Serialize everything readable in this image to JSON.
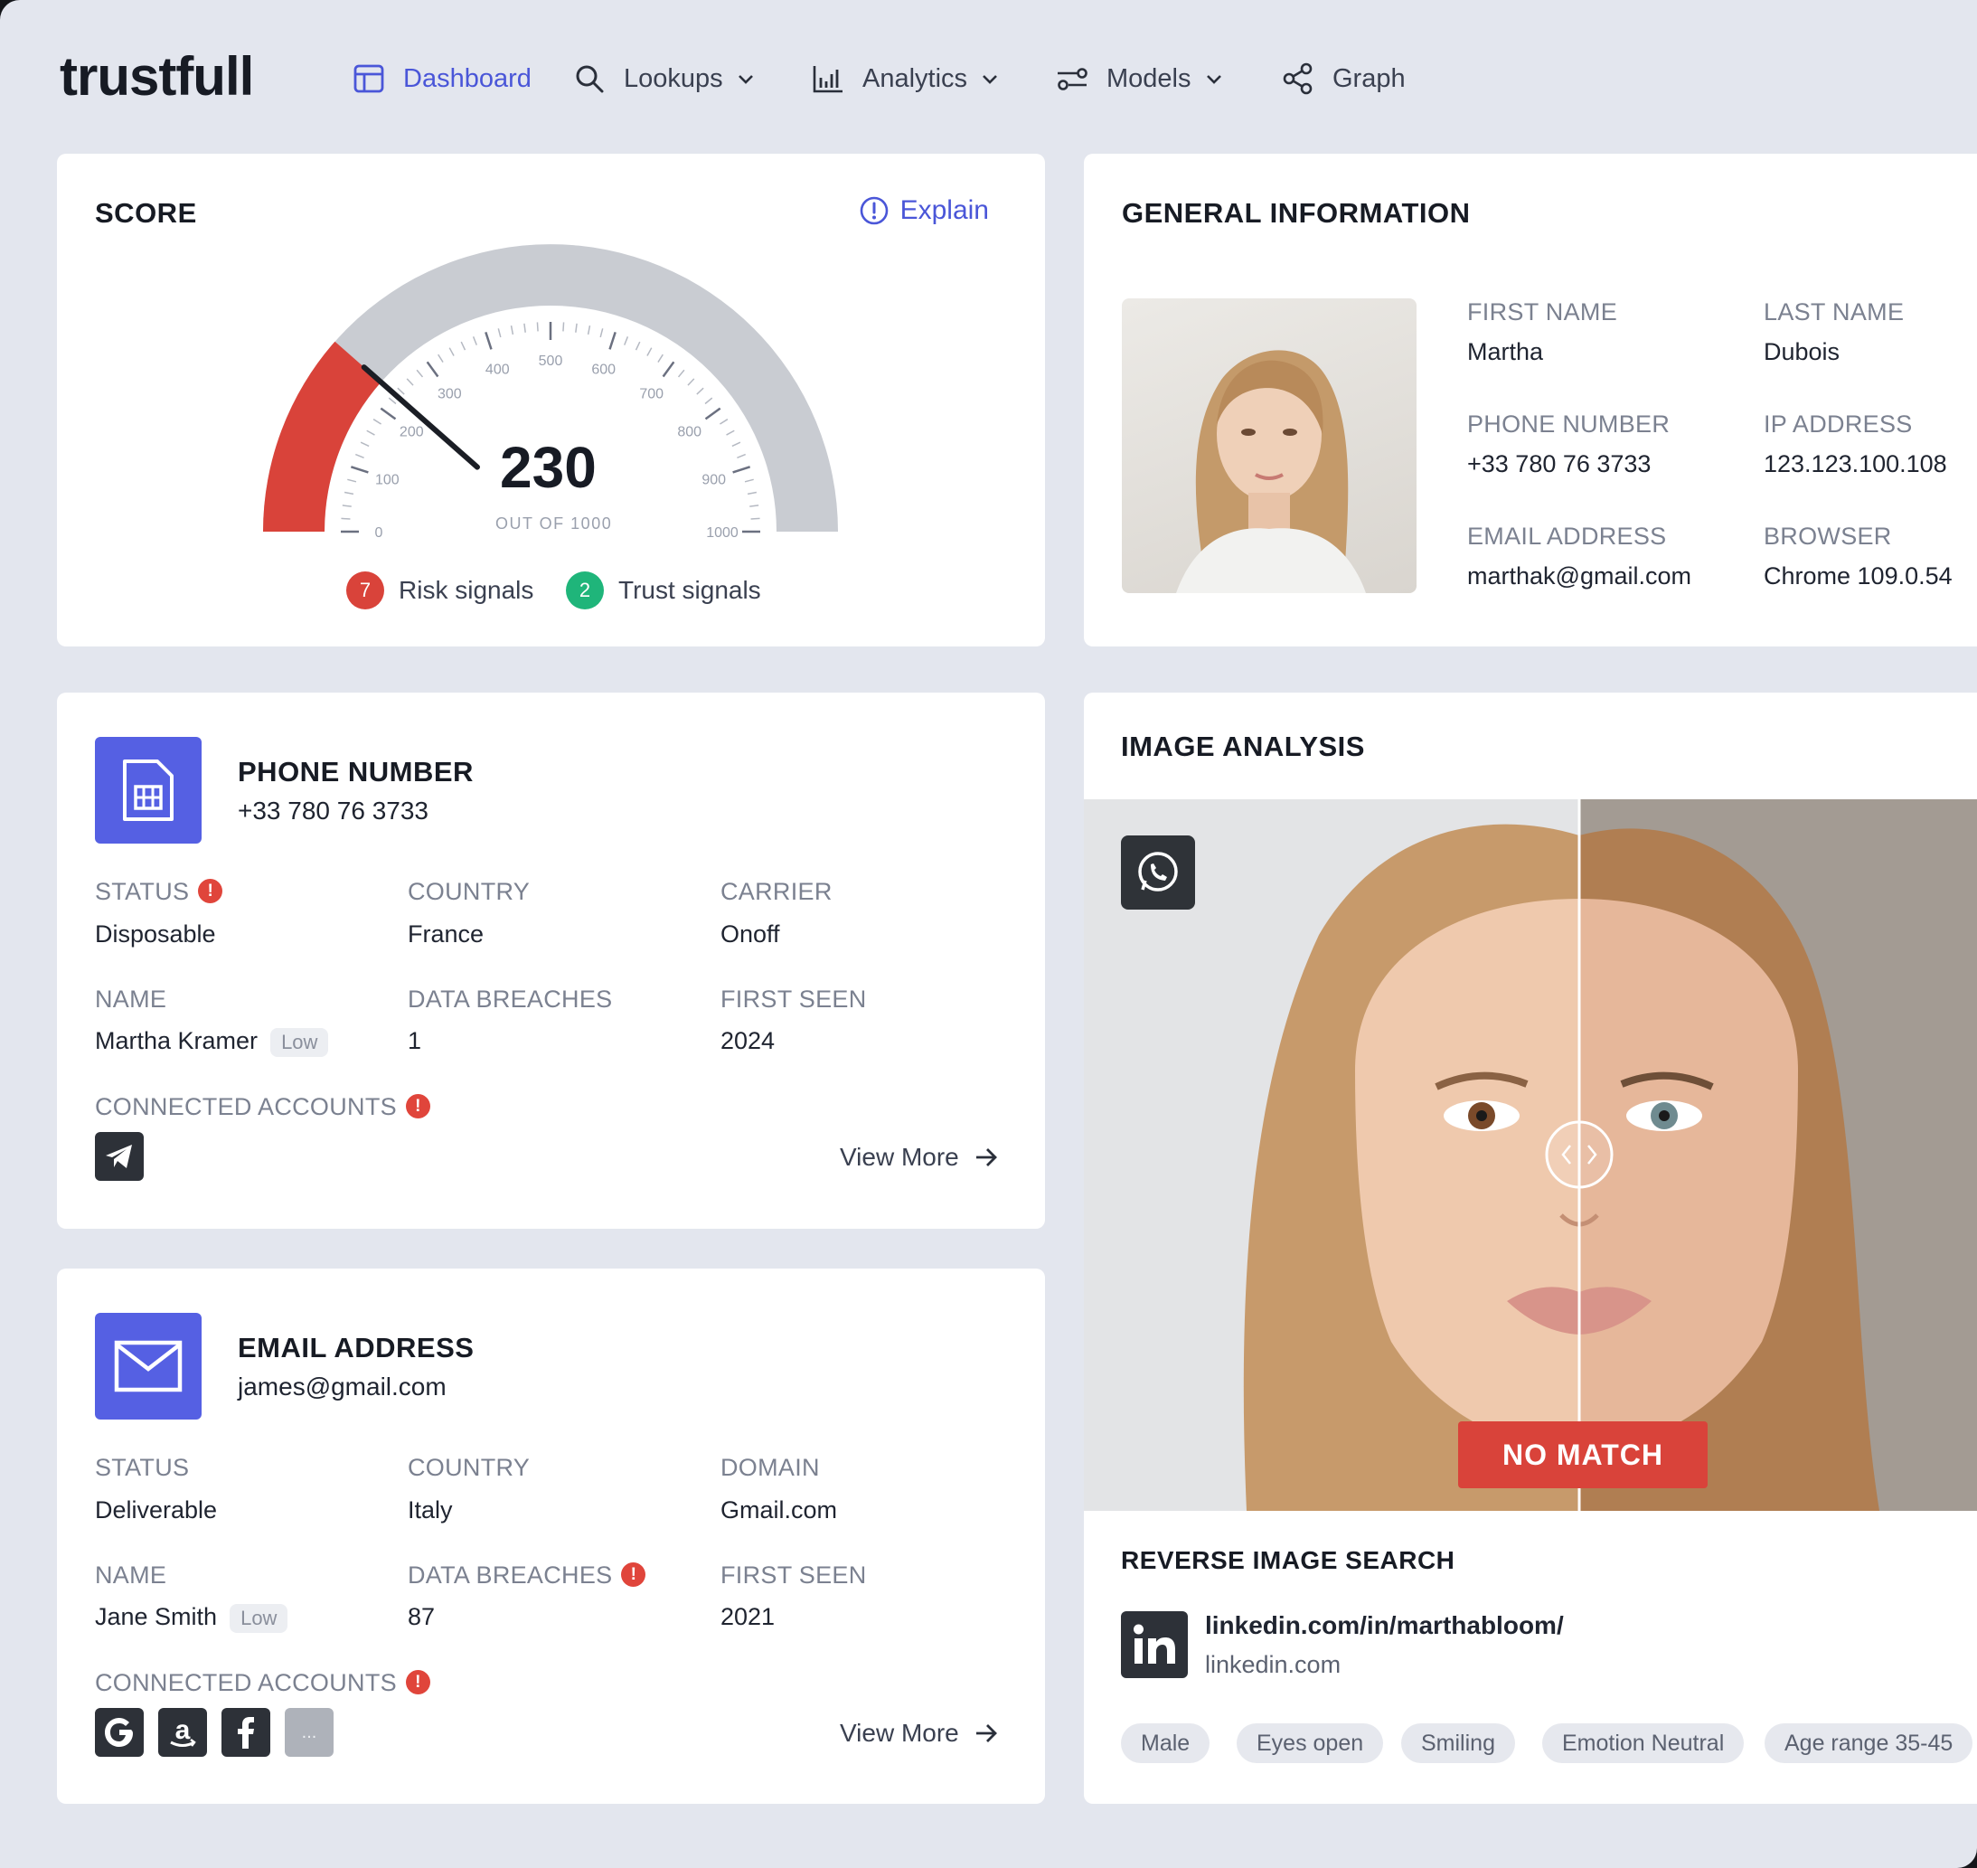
{
  "brand": "trustfull",
  "nav": {
    "dashboard": "Dashboard",
    "lookups": "Lookups",
    "analytics": "Analytics",
    "models": "Models",
    "graph": "Graph"
  },
  "score": {
    "title": "SCORE",
    "explain": "Explain",
    "value": "230",
    "out_of": "OUT OF 1000",
    "ticks": [
      "0",
      "100",
      "200",
      "300",
      "400",
      "500",
      "600",
      "700",
      "800",
      "900",
      "1000"
    ],
    "risk_count": "7",
    "risk_label": "Risk signals",
    "trust_count": "2",
    "trust_label": "Trust signals"
  },
  "general": {
    "title": "GENERAL INFORMATION",
    "first_name_label": "FIRST NAME",
    "first_name": "Martha",
    "last_name_label": "LAST NAME",
    "last_name": "Dubois",
    "phone_label": "PHONE NUMBER",
    "phone": "+33 780 76 3733",
    "ip_label": "IP ADDRESS",
    "ip": "123.123.100.108",
    "email_label": "EMAIL ADDRESS",
    "email": "marthak@gmail.com",
    "browser_label": "BROWSER",
    "browser": "Chrome 109.0.54"
  },
  "phone_card": {
    "title": "PHONE NUMBER",
    "number": "+33 780 76 3733",
    "status_label": "STATUS",
    "status": "Disposable",
    "country_label": "COUNTRY",
    "country": "France",
    "carrier_label": "CARRIER",
    "carrier": "Onoff",
    "name_label": "NAME",
    "name": "Martha Kramer",
    "name_badge": "Low",
    "breaches_label": "DATA BREACHES",
    "breaches": "1",
    "first_seen_label": "FIRST SEEN",
    "first_seen": "2024",
    "connected_label": "CONNECTED ACCOUNTS",
    "view_more": "View More"
  },
  "email_card": {
    "title": "EMAIL ADDRESS",
    "address": "james@gmail.com",
    "status_label": "STATUS",
    "status": "Deliverable",
    "country_label": "COUNTRY",
    "country": "Italy",
    "domain_label": "DOMAIN",
    "domain": "Gmail.com",
    "name_label": "NAME",
    "name": "Jane Smith",
    "name_badge": "Low",
    "breaches_label": "DATA BREACHES",
    "breaches": "87",
    "first_seen_label": "FIRST SEEN",
    "first_seen": "2021",
    "connected_label": "CONNECTED ACCOUNTS",
    "more_accounts": "...",
    "view_more": "View More"
  },
  "image_analysis": {
    "title": "IMAGE ANALYSIS",
    "result": "NO MATCH",
    "reverse_title": "REVERSE IMAGE SEARCH",
    "link": "linkedin.com/in/marthabloom/",
    "domain": "linkedin.com",
    "tags": [
      "Male",
      "Eyes open",
      "Smiling",
      "Emotion Neutral",
      "Age range 35-45"
    ]
  },
  "colors": {
    "accent": "#4a56d8",
    "risk": "#d9433a",
    "trust": "#1fb57a",
    "icon_bg": "#5560e3"
  }
}
